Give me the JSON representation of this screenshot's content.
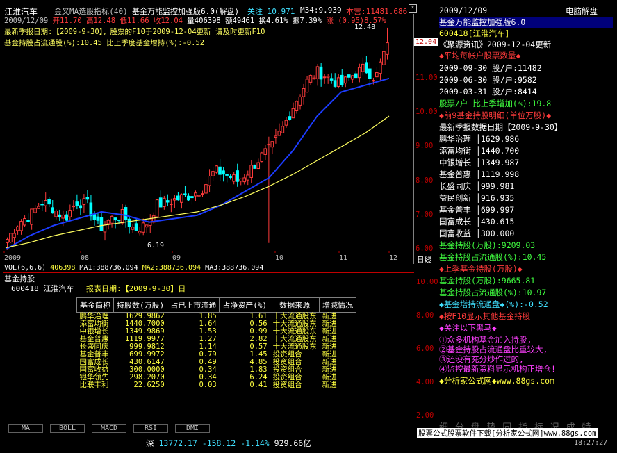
{
  "header": {
    "stock_name": "江淮汽车",
    "indicator": "金叉MA选股指标(40)",
    "formula_name": "基金万能监控加强版6.0(解盘)",
    "attention": "关注 10.971",
    "m34": "M34:9.939",
    "cost": "本营:11481.686"
  },
  "quote_line": {
    "date": "2009/12/09",
    "open": "开11.70",
    "high": "高12.48",
    "low": "低11.66",
    "close": "收12.04",
    "volume": "量406398",
    "amount": "额49461",
    "turnover": "换4.61%",
    "amplitude": "振7.39%",
    "change": "涨 (0.95)8.57%"
  },
  "notice_line1": "最新季报日期:【2009-9-30】，股票的F10于2009-12-04更新 请及时更新F10",
  "notice_line2": "基金持股占流通股(%):10.45 比上季度基金增持(%):-0.52",
  "price_labels": {
    "high_mark": "12.48",
    "low_mark": "6.19",
    "current": "12.04"
  },
  "y_axis_ticks": [
    "11.00",
    "10.00",
    "9.00",
    "8.00",
    "7.00",
    "6.00"
  ],
  "y_axis_values": [
    11,
    10,
    9,
    8,
    7,
    6
  ],
  "x_axis_labels": [
    "2009",
    "08",
    "09",
    "10",
    "11",
    "12"
  ],
  "x_axis_end": "日线",
  "ma_line": {
    "vol": "VOL(6,6,6)",
    "vol_value": "406398",
    "ma1": "MA1:388736.094",
    "ma2": "MA2:388736.094",
    "ma3": "MA3:388736.094"
  },
  "lower": {
    "title": "基金持股",
    "code": "600418",
    "name": "江淮汽车",
    "report_date": "报表日期:【2009-9-30】日",
    "columns": [
      "基金简称",
      "持股数(万股)",
      "占已上市流通",
      "占净资产(%)",
      "数据来源",
      "增减情况"
    ],
    "rows": [
      [
        "鹏华治理",
        "1629.9862",
        "1.85",
        "1.61",
        "十大流通股东",
        "新进"
      ],
      [
        "添富均衡",
        "1440.7000",
        "1.64",
        "0.56",
        "十大流通股东",
        "新进"
      ],
      [
        "中银增长",
        "1349.9869",
        "1.53",
        "0.99",
        "十大流通股东",
        "新进"
      ],
      [
        "基金普惠",
        "1119.9977",
        "1.27",
        "2.82",
        "十大流通股东",
        "新进"
      ],
      [
        "长盛同庆",
        "999.9812",
        "1.14",
        "0.57",
        "十大流通股东",
        "新进"
      ],
      [
        "基金普丰",
        "699.9972",
        "0.79",
        "1.45",
        "投资组合",
        "新进"
      ],
      [
        "国富成长",
        "430.6147",
        "0.49",
        "4.85",
        "投资组合",
        "新进"
      ],
      [
        "国富收益",
        "300.0000",
        "0.34",
        "1.83",
        "投资组合",
        "新进"
      ],
      [
        "银华领先",
        "298.2070",
        "0.34",
        "6.24",
        "投资组合",
        "新进"
      ],
      [
        "比联丰利",
        "22.6250",
        "0.03",
        "0.41",
        "投资组合",
        "新进"
      ]
    ],
    "axis_ticks": [
      "10.00",
      "8.00",
      "6.00",
      "4.00",
      "2.00"
    ]
  },
  "panel": {
    "date": "2009/12/09",
    "mode": "电脑解盘",
    "title": "基金万能监控加强版6.0",
    "code": "600418[江淮汽车]",
    "news": "《聚源资讯》2009-12-04更新",
    "section1": "◆平均每帐户股票数量◆",
    "h1": "2009-09-30 股/户:11482",
    "h2": "2009-06-30 股/户:9582",
    "h3": "2009-03-31 股/户:8414",
    "ratio": "股票/户 比上季增加(%):19.8",
    "section2": "◆前9基金持股明细(单位万股)◆",
    "report": "最新季报数据日期【2009-9-30】",
    "funds": [
      "鹏华治理 │1629.986",
      "添富均衡 │1440.700",
      "中银增长 │1349.987",
      "基金普惠 │1119.998",
      "长盛同庆 │999.981",
      "益民创新 │916.935",
      "基金普丰 │699.997",
      "国富成长 │430.615",
      "国富收益 │300.000"
    ],
    "hold_total": "基金持股(万股):9209.03",
    "hold_pct": "基金持股占流通股(%):10.45",
    "section3": "◆上季基金持股(万股)◆",
    "prev_total": "基金持股(万股):9665.81",
    "prev_pct": "基金持股占流通股(%):10.97",
    "increase": "◆基金增持流通盘◆(%):-0.52",
    "section4": "◆按F10显示其他基金持股",
    "section5": "◆关注以下黑马◆",
    "tips": [
      "①众多机构基金加入持股,",
      "②基金持股占流通盘比重较大,",
      "③还没有充分炒作过的,",
      "④监控最新资料显示机构正增仓!"
    ],
    "footer": "◆分析家公式网◆www.88gs.com"
  },
  "tabs": [
    "MA",
    "BOLL",
    "MACD",
    "RSI",
    "DMI"
  ],
  "status": {
    "market": "深",
    "index": "13772.17",
    "change": "-158.12",
    "pct": "-1.14%",
    "amount": "929.66亿",
    "banner": "股票公式股票软件下载[分析家公式网]www.88gs.com",
    "time": "18:27:27",
    "right_chars": "细 分 盘 势 同 指 标 况 成 特"
  },
  "colors": {
    "up": "#ff3b3b",
    "down": "#00ffff",
    "ma_blue": "#1c3cff",
    "ma_yellow": "#ffff60",
    "ma_white": "#ffffff",
    "highlight": "#ff3333"
  },
  "chart_data": {
    "type": "candlestick",
    "y_range": [
      5.9,
      12.6
    ],
    "x_labels": [
      "2009",
      "08",
      "09",
      "10",
      "11",
      "12"
    ],
    "highest": 12.48,
    "lowest": 6.19,
    "last_close": 12.04,
    "series": [
      {
        "name": "MA1",
        "values": [
          6.0,
          6.4,
          6.7,
          6.9,
          7.1,
          7.0,
          6.8,
          6.9,
          7.0,
          7.3,
          7.7,
          8.1,
          8.9,
          9.9,
          10.6,
          10.8,
          11.0
        ]
      },
      {
        "name": "MA2",
        "values": [
          6.05,
          6.2,
          6.4,
          6.55,
          6.7,
          6.8,
          6.9,
          7.0,
          7.1,
          7.3,
          7.55,
          7.85,
          8.2,
          8.6,
          9.0,
          9.4,
          9.9
        ]
      }
    ]
  }
}
